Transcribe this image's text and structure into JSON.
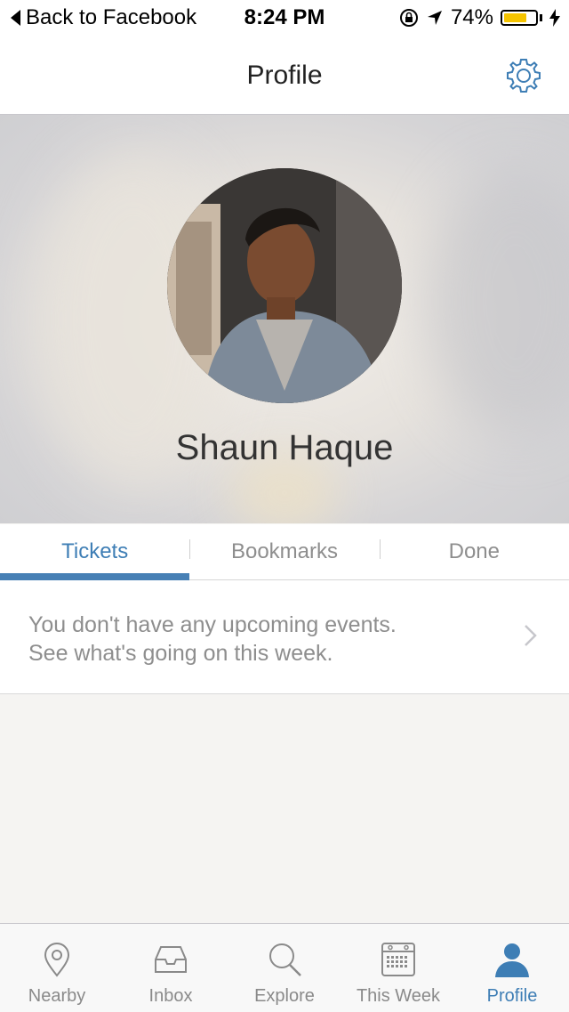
{
  "status_bar": {
    "back_label": "Back to Facebook",
    "time": "8:24 PM",
    "battery_percent": "74%",
    "battery_level": 0.74
  },
  "nav": {
    "title": "Profile",
    "settings_icon": "gear-icon"
  },
  "profile": {
    "name": "Shaun Haque"
  },
  "tabs": [
    {
      "label": "Tickets",
      "active": true
    },
    {
      "label": "Bookmarks",
      "active": false
    },
    {
      "label": "Done",
      "active": false
    }
  ],
  "empty_state": {
    "line1": "You don't have any upcoming events.",
    "line2": "See what's going on this week."
  },
  "tab_bar": [
    {
      "label": "Nearby",
      "icon": "map-pin-icon",
      "active": false
    },
    {
      "label": "Inbox",
      "icon": "inbox-tray-icon",
      "active": false
    },
    {
      "label": "Explore",
      "icon": "search-icon",
      "active": false
    },
    {
      "label": "This Week",
      "icon": "calendar-icon",
      "active": false
    },
    {
      "label": "Profile",
      "icon": "person-icon",
      "active": true
    }
  ],
  "colors": {
    "accent": "#3e7eb5",
    "battery": "#f5c400",
    "inactive": "#8a8a8a"
  }
}
